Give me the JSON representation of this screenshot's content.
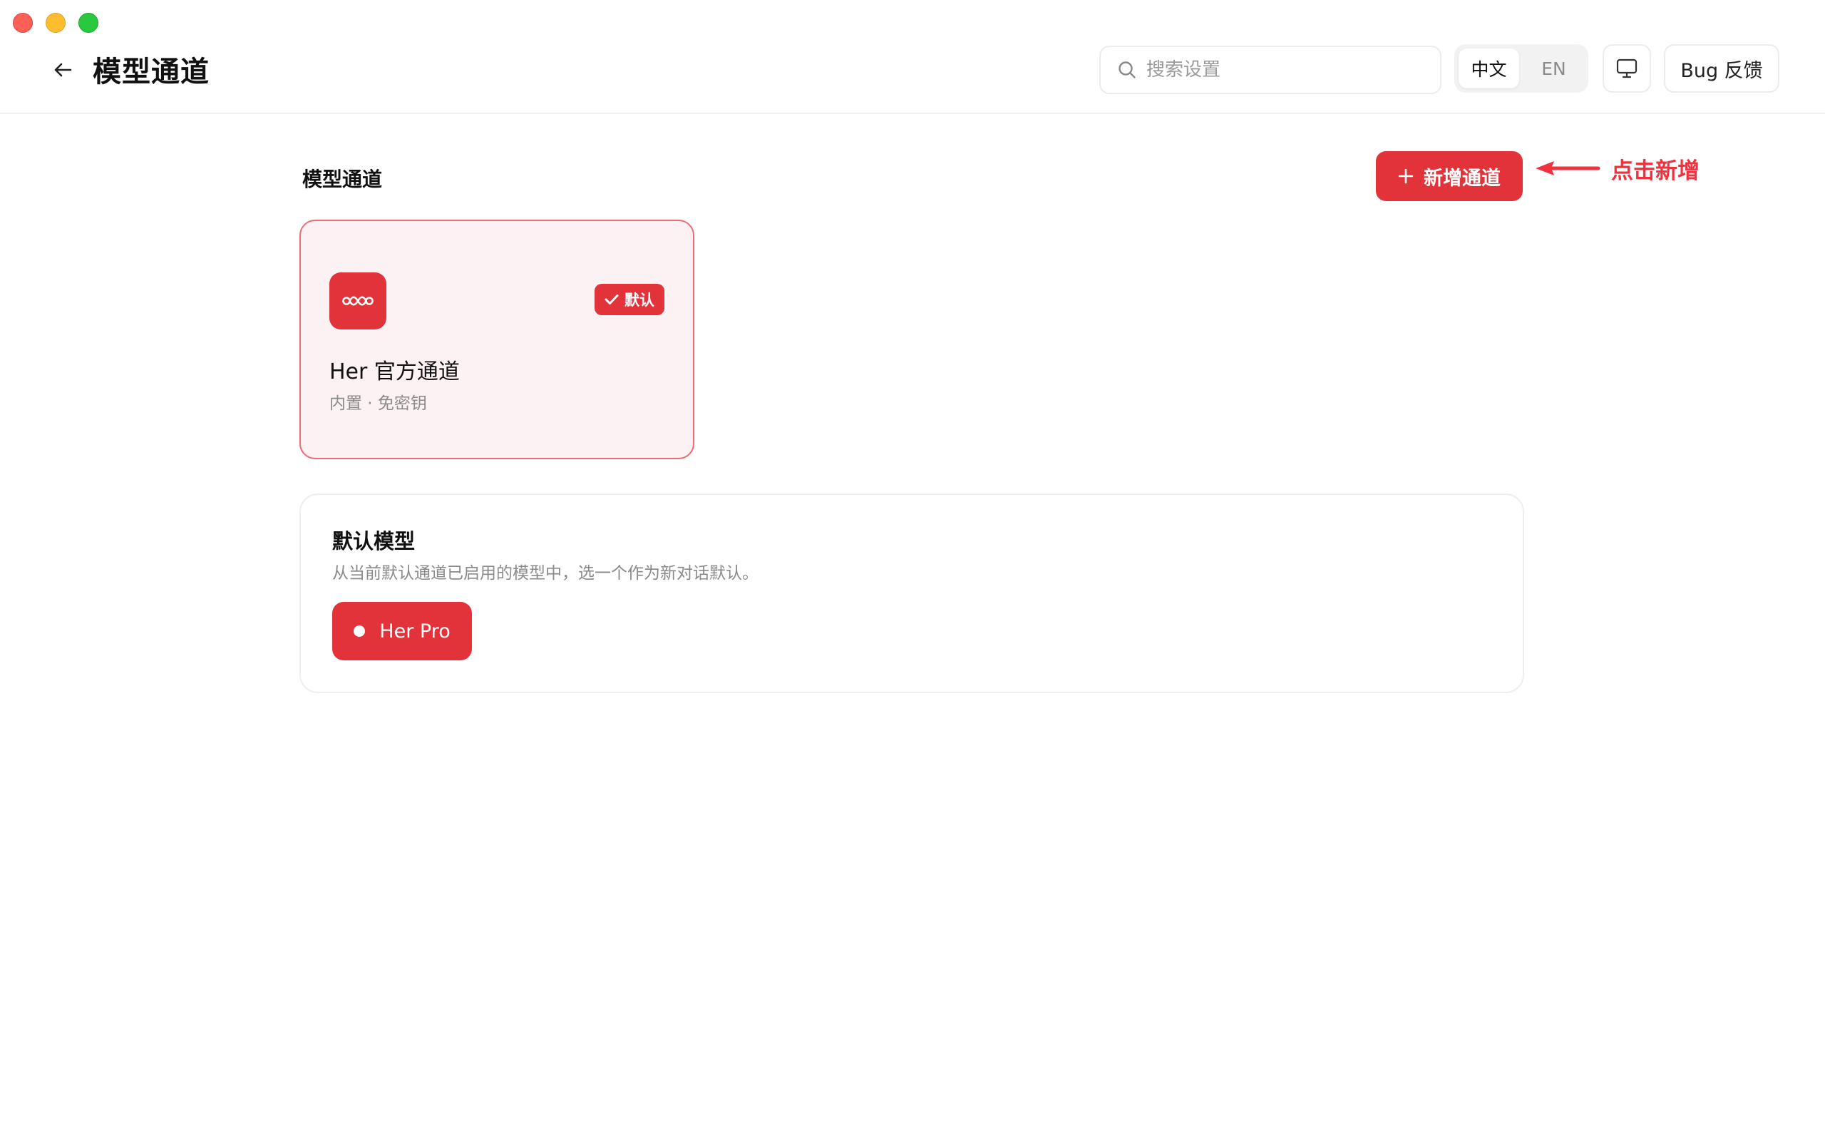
{
  "header": {
    "title": "模型通道",
    "search_placeholder": "搜索设置",
    "lang_options": [
      "中文",
      "EN"
    ],
    "lang_active": "中文",
    "bug_label": "Bug 反馈"
  },
  "section": {
    "title": "模型通道",
    "add_label": "新增通道",
    "annotation": "点击新增"
  },
  "channel": {
    "badge": "默认",
    "name": "Her 官方通道",
    "meta": "内置 · 免密钥"
  },
  "default_model": {
    "title": "默认模型",
    "description": "从当前默认通道已启用的模型中，选一个作为新对话默认。",
    "selected": "Her Pro"
  },
  "colors": {
    "accent": "#e2333a",
    "annotation": "#f0323f",
    "card_bg": "#fdf2f3",
    "card_border": "#ef6b72"
  },
  "icons": [
    "back-arrow-icon",
    "search-icon",
    "monitor-icon",
    "plus-icon",
    "check-icon",
    "infinity-icon",
    "annotation-arrow-icon"
  ]
}
